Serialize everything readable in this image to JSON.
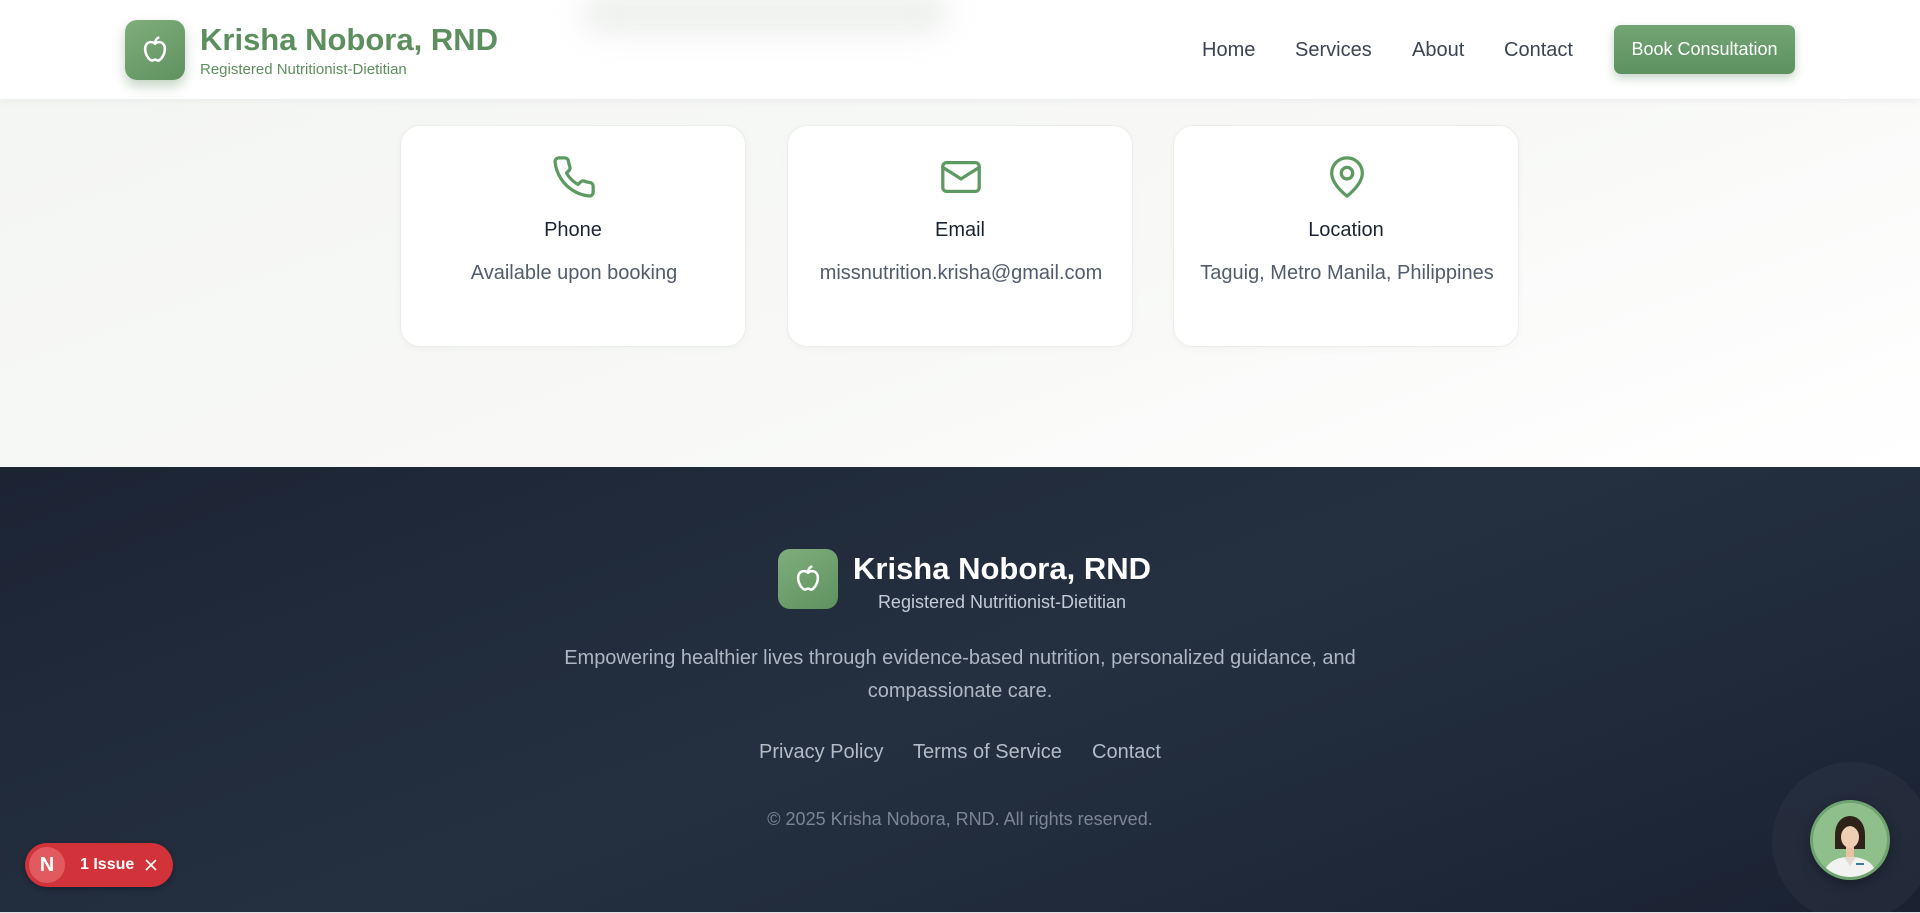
{
  "header": {
    "brand_name": "Krisha Nobora, RND",
    "brand_subtitle": "Registered Nutritionist-Dietitian",
    "logo_icon": "apple-icon",
    "nav": [
      "Home",
      "Services",
      "About",
      "Contact"
    ],
    "cta_label": "Book Consultation"
  },
  "contact_cards": [
    {
      "icon": "phone-icon",
      "title": "Phone",
      "value": "Available upon booking"
    },
    {
      "icon": "mail-icon",
      "title": "Email",
      "value": "missnutrition.krisha@gmail.com"
    },
    {
      "icon": "map-pin-icon",
      "title": "Location",
      "value": "Taguig, Metro Manila, Philippines"
    }
  ],
  "footer": {
    "brand_name": "Krisha Nobora, RND",
    "brand_subtitle": "Registered Nutritionist-Dietitian",
    "tagline": "Empowering healthier lives through evidence-based nutrition, personalized guidance, and compassionate care.",
    "links": [
      "Privacy Policy",
      "Terms of Service",
      "Contact"
    ],
    "copyright": "© 2025 Krisha Nobora, RND. All rights reserved."
  },
  "issue_badge": {
    "letter": "N",
    "label": "1 Issue"
  },
  "colors": {
    "accent_green": "#5c8f5d",
    "footer_bg": "#1c2434",
    "badge_red": "#d2333a"
  }
}
